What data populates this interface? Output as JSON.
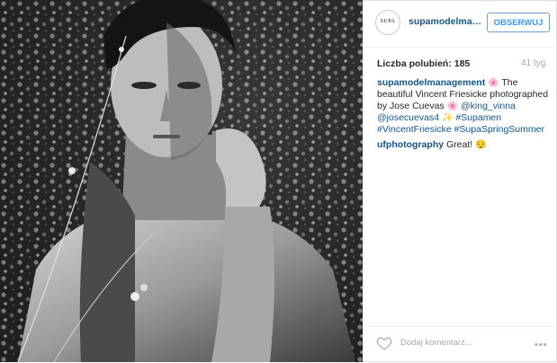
{
  "post": {
    "avatar_text": "SUPA",
    "username": "supamodelmanagement",
    "username_display": "supamodelmanage...",
    "follow_label": "OBSERWUJ",
    "likes": "Liczba polubień: 185",
    "time": "41 tyg.",
    "caption": {
      "user": "supamodelmanagement",
      "text1": "The beautiful Vincent Friesicke photographed by Jose Cuevas",
      "mention1": "@king_vinna",
      "mention2": "@josecuevas4",
      "hashtags": "#Supamen #VincentFriesicke #SupaSpringSummer"
    },
    "comment": {
      "user": "ufphotography",
      "text": "Great!"
    },
    "add_comment_placeholder": "Dodaj komentarz...",
    "more_label": "•••"
  }
}
